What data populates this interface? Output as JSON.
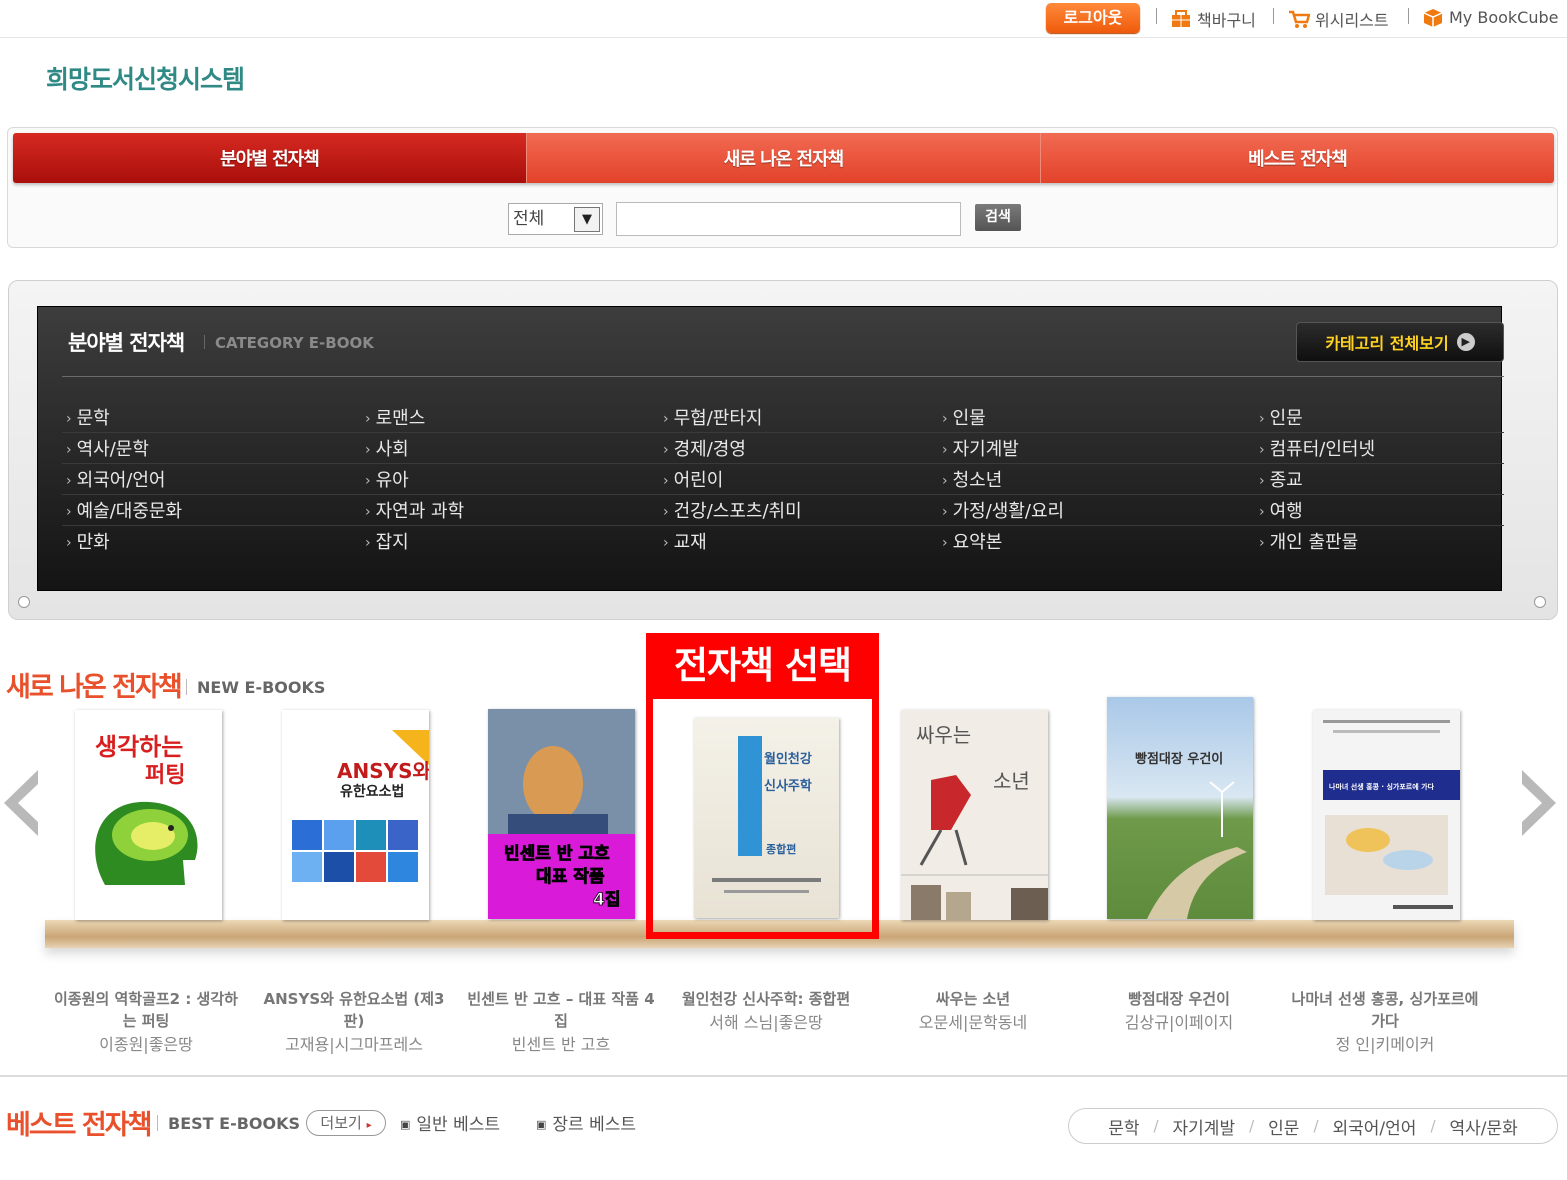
{
  "topbar": {
    "logout": "로그아웃",
    "cart": "책바구니",
    "wishlist": "위시리스트",
    "mybookcube": "My BookCube"
  },
  "site_title": "희망도서신청시스템",
  "nav": {
    "tabs": [
      {
        "label": "분야별 전자책",
        "active": true
      },
      {
        "label": "새로 나온 전자책",
        "active": false
      },
      {
        "label": "베스트 전자책",
        "active": false
      }
    ]
  },
  "search": {
    "select_value": "전체",
    "input_value": "",
    "button": "검색"
  },
  "category": {
    "title": "분야별 전자책",
    "subtitle": "CATEGORY E-BOOK",
    "view_all": "카테고리 전체보기",
    "rows": [
      [
        "문학",
        "로맨스",
        "무협/판타지",
        "인물",
        "인문"
      ],
      [
        "역사/문학",
        "사회",
        "경제/경영",
        "자기계발",
        "컴퓨터/인터넷"
      ],
      [
        "외국어/언어",
        "유아",
        "어린이",
        "청소년",
        "종교"
      ],
      [
        "예술/대중문화",
        "자연과 과학",
        "건강/스포츠/취미",
        "가정/생활/요리",
        "여행"
      ],
      [
        "만화",
        "잡지",
        "교재",
        "요약본",
        "개인 출판물"
      ]
    ]
  },
  "new_ebooks": {
    "title": "새로 나온 전자책",
    "subtitle": "NEW E-BOOKS",
    "highlight_label": "전자책 선택",
    "books": [
      {
        "title": "이종원의 역학골프2 : 생각하는 퍼팅",
        "author": "이종원|좋은땅",
        "cover_text": [
          "생각하는",
          "퍼팅"
        ]
      },
      {
        "title": "ANSYS와 유한요소법 (제3판)",
        "author": "고재용|시그마프레스",
        "cover_text": [
          "ANSYS와",
          "유한요소법"
        ]
      },
      {
        "title": "빈센트 반 고흐 – 대표 작품 4집",
        "author": "빈센트 반 고흐",
        "cover_text": [
          "빈센트 반 고흐",
          "대표 작품",
          "4집"
        ]
      },
      {
        "title": "월인천강 신사주학: 종합편",
        "author": "서해 스님|좋은땅",
        "cover_text": [
          "월인천강",
          "신사주학",
          "종합편"
        ]
      },
      {
        "title": "싸우는 소년",
        "author": "오문세|문학동네",
        "cover_text": [
          "싸우는",
          "소년"
        ]
      },
      {
        "title": "빵점대장 우건이",
        "author": "김상규|이페이지",
        "cover_text": [
          "빵점대장 우건이"
        ]
      },
      {
        "title": "나마녀 선생 홍콩, 싱가포르에 가다",
        "author": "정 인|키메이커",
        "cover_text": [
          "나마녀 선생 홍콩 · 싱가포르에 가다"
        ]
      }
    ]
  },
  "best_ebooks": {
    "title": "베스트 전자책",
    "subtitle": "BEST E-BOOKS",
    "more": "더보기",
    "links": [
      "일반 베스트",
      "장르 베스트"
    ],
    "genres": [
      "문학",
      "자기계발",
      "인문",
      "외국어/언어",
      "역사/문화"
    ]
  },
  "colors": {
    "accent": "#e8512b",
    "nav_active": "#b8140e",
    "highlight": "#ff0000",
    "title_teal": "#2f8a86"
  }
}
